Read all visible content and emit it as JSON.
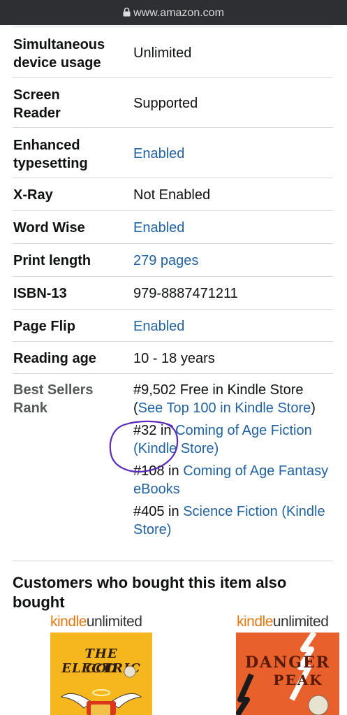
{
  "browser": {
    "url": "www.amazon.com"
  },
  "details": [
    {
      "label": "Simultaneous device usage",
      "value": "Unlimited",
      "is_link": false
    },
    {
      "label": "Screen Reader",
      "value": "Supported",
      "is_link": false
    },
    {
      "label": "Enhanced typesetting",
      "value": "Enabled",
      "is_link": true
    },
    {
      "label": "X-Ray",
      "value": "Not Enabled",
      "is_link": false
    },
    {
      "label": "Word Wise",
      "value": "Enabled",
      "is_link": true
    },
    {
      "label": "Print length",
      "value": "279 pages",
      "is_link": true
    },
    {
      "label": "ISBN-13",
      "value": "979-8887471211",
      "is_link": false
    },
    {
      "label": "Page Flip",
      "value": "Enabled",
      "is_link": true
    },
    {
      "label": "Reading age",
      "value": "10 - 18 years",
      "is_link": false
    }
  ],
  "best_sellers": {
    "label": "Best Sellers Rank",
    "entries": [
      {
        "rank": "#9,502 Free in Kindle Store",
        "paren_open": "(",
        "link": "See Top 100 in Kindle Store",
        "paren_close": ")"
      },
      {
        "rank": "#32 in",
        "link": "Coming of Age Fiction (Kindle Store)"
      },
      {
        "rank": "#108 in",
        "link": "Coming of Age Fantasy eBooks"
      },
      {
        "rank": "#405 in",
        "link": "Science Fiction (Kindle Store)"
      }
    ]
  },
  "also_bought": {
    "title": "Customers who bought this item also bought",
    "items": [
      {
        "badge_kindle": "kindle",
        "badge_unlimited": "unlimited",
        "cover_text": [
          "THE ELECTRIC",
          "GOD"
        ]
      },
      {
        "badge_kindle": "kindle",
        "badge_unlimited": "unlimited",
        "cover_text": [
          "DANGER",
          "PEAK"
        ]
      }
    ]
  },
  "colors": {
    "link": "#2162a1",
    "kindle_orange": "#e47911",
    "topbar": "#2d2f33",
    "annotation": "#5b2bb8"
  }
}
